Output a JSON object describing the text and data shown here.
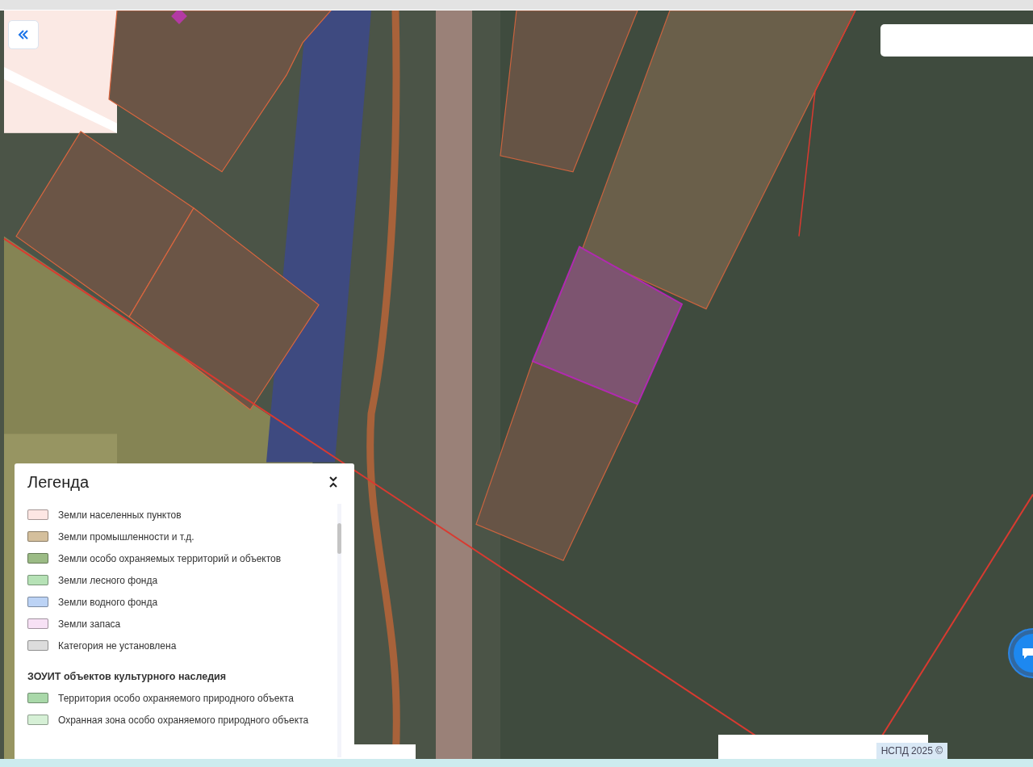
{
  "legend": {
    "title": "Легенда",
    "items": [
      {
        "label": "Земли населенных пунктов",
        "color": "#fde6e3"
      },
      {
        "label": "Земли промышленности и т.д.",
        "color": "#d4bf9c"
      },
      {
        "label": "Земли особо охраняемых территорий и объектов",
        "color": "#9bbb85"
      },
      {
        "label": "Земли лесного фонда",
        "color": "#b6e2b6"
      },
      {
        "label": "Земли водного фонда",
        "color": "#bcd3f5"
      },
      {
        "label": "Земли запаса",
        "color": "#f7e1f5"
      },
      {
        "label": "Категория не установлена",
        "color": "#dcdcdc"
      }
    ],
    "section": {
      "title": "ЗОУИТ объектов культурного наследия",
      "items": [
        {
          "label": "Территория особо охраняемого природного объекта",
          "color": "#a9d8a9"
        },
        {
          "label": "Охранная зона особо охраняемого природного объекта",
          "color": "#d6f0d6"
        }
      ]
    }
  },
  "attribution": "НСПД 2025 ©"
}
